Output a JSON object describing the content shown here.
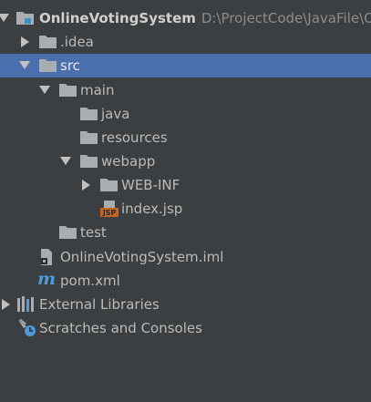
{
  "colors": {
    "background": "#3c3f41",
    "selection": "#4b6eaf",
    "text": "#bbbbbb",
    "folder": "#a9adb1",
    "module_marker": "#3592c4",
    "jsp_badge": "#c8641e",
    "maven": "#4e9ad6"
  },
  "tree": {
    "root": {
      "label": "OnlineVotingSystem",
      "path": "D:\\ProjectCode\\JavaFile\\Onl",
      "icon": "module-folder-icon"
    },
    "idea": {
      "label": ".idea",
      "icon": "folder-icon"
    },
    "src": {
      "label": "src",
      "icon": "folder-icon"
    },
    "main": {
      "label": "main",
      "icon": "folder-icon"
    },
    "java": {
      "label": "java",
      "icon": "folder-icon"
    },
    "resources": {
      "label": "resources",
      "icon": "folder-icon"
    },
    "webapp": {
      "label": "webapp",
      "icon": "folder-icon"
    },
    "webinf": {
      "label": "WEB-INF",
      "icon": "folder-icon"
    },
    "indexjsp": {
      "label": "index.jsp",
      "icon": "jsp-file-icon",
      "badge": "JSP"
    },
    "test": {
      "label": "test",
      "icon": "folder-icon"
    },
    "iml": {
      "label": "OnlineVotingSystem.iml",
      "icon": "iml-file-icon"
    },
    "pom": {
      "label": "pom.xml",
      "icon": "maven-icon",
      "glyph": "m"
    },
    "libs": {
      "label": "External Libraries",
      "icon": "library-icon"
    },
    "scratches": {
      "label": "Scratches and Consoles",
      "icon": "scratches-icon"
    }
  }
}
